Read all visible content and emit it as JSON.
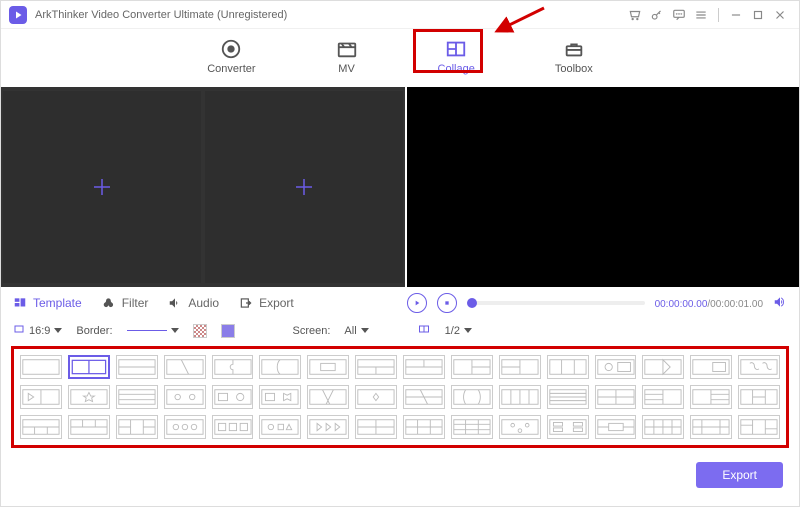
{
  "title": "ArkThinker Video Converter Ultimate (Unregistered)",
  "nav": {
    "converter": "Converter",
    "mv": "MV",
    "collage": "Collage",
    "toolbox": "Toolbox"
  },
  "tabs": {
    "template": "Template",
    "filter": "Filter",
    "audio": "Audio",
    "export": "Export"
  },
  "options": {
    "ratio": "16:9",
    "border_label": "Border:",
    "screen_label": "Screen:",
    "screen_value": "All",
    "split_value": "1/2"
  },
  "player": {
    "current": "00:00:00.00",
    "duration": "00:00:01.00",
    "sep": "/"
  },
  "buttons": {
    "export": "Export"
  }
}
